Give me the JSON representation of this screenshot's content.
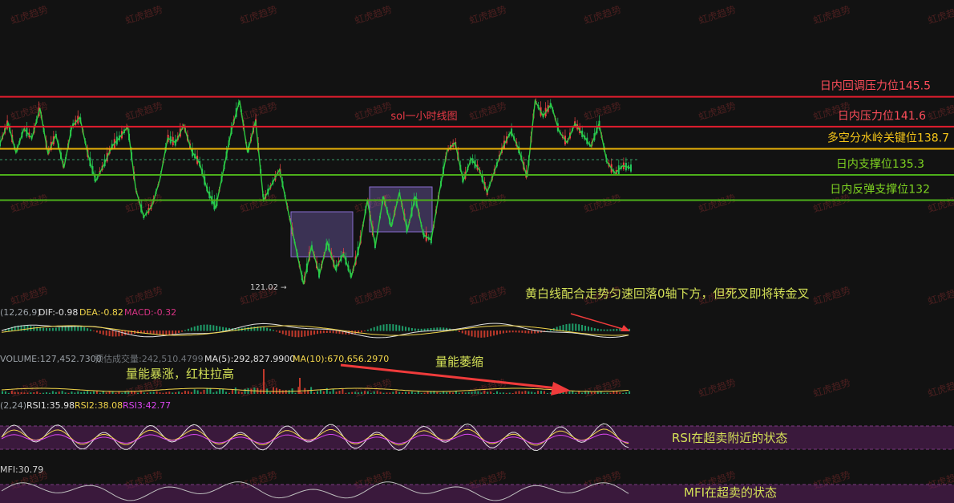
{
  "watermark": "虹虎趋势",
  "colors": {
    "background": "#121212",
    "up": "#22c55e",
    "down": "#ef4444",
    "red_line": "#e11d2e",
    "yellow_line": "#eab308",
    "green_line": "#4caf1a",
    "box_fill": "#8a6fd1",
    "yellow": "#f0d44a",
    "white": "#d9d9d9",
    "magenta": "#d946ef",
    "zone_fill": "#5b1f5e",
    "annotation": "#d4e157",
    "arrow": "#ef3b3b"
  },
  "chart_data": {
    "type": "line",
    "title": "sol一小时线图",
    "price_levels": [
      {
        "label": "日内回调压力位145.5",
        "value": 145.5,
        "color": "red"
      },
      {
        "label": "日内压力位141.6",
        "value": 141.6,
        "color": "red"
      },
      {
        "label": "多空分水岭关键位138.7",
        "value": 138.7,
        "color": "yellow"
      },
      {
        "label": "日内支撑位135.3",
        "value": 135.3,
        "color": "green"
      },
      {
        "label": "日内反弹支撑位132",
        "value": 132,
        "color": "green"
      }
    ],
    "low_marker": "121.02",
    "price_path": [
      139.4,
      142.1,
      138.2,
      141.3,
      140.1,
      144.0,
      138.1,
      140.5,
      136.2,
      141.6,
      142.8,
      138.0,
      134.5,
      136.6,
      139.0,
      140.2,
      141.6,
      133.4,
      129.8,
      131.2,
      134.6,
      140.1,
      139.5,
      141.8,
      138.4,
      136.8,
      133.2,
      131.0,
      136.0,
      141.2,
      145.0,
      138.2,
      142.4,
      132.0,
      134.0,
      136.0,
      131.0,
      126.0,
      121.02,
      126.0,
      122.3,
      126.5,
      123.0,
      125.0,
      122.0,
      126.0,
      132.0,
      126.0,
      132.5,
      128.5,
      133.0,
      128.0,
      132.5,
      127.5,
      126.8,
      133.0,
      138.5,
      139.5,
      134.5,
      137.4,
      136.0,
      133.0,
      136.0,
      139.0,
      141.0,
      138.5,
      135.0,
      145.0,
      143.0,
      144.5,
      141.0,
      139.5,
      142.0,
      140.5,
      139.0,
      142.0,
      137.0,
      135.5,
      136.5,
      136.2
    ],
    "macd": {
      "label": "(12,26,9)",
      "dif": "DIF:-0.98",
      "dea": "DEA:-0.82",
      "macd": "MACD:-0.32"
    },
    "volume": {
      "label": "VOLUME:127,452.7300",
      "estimate": "预估成交量:242,510.4799",
      "ma5": "MA(5):292,827.9900",
      "ma10": "MA(10):670,656.2970"
    },
    "rsi": {
      "label": "(2,24)",
      "rsi1": "RSI1:35.98",
      "rsi2": "RSI2:38.08",
      "rsi3": "RSI3:42.77"
    },
    "mfi": {
      "label": "MFI:30.79"
    }
  },
  "annotations": {
    "macd_note": "黄白线配合走势匀速回落0轴下方，但死叉即将转金叉",
    "volume_spike": "量能暴涨，红柱拉高",
    "volume_shrink": "量能萎缩",
    "rsi_note": "RSI在超卖附近的状态",
    "mfi_note": "MFI在超卖的状态"
  }
}
